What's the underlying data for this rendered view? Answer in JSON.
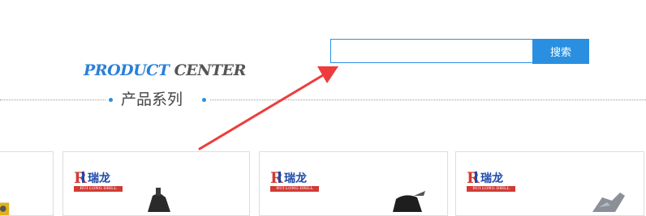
{
  "search": {
    "placeholder": "",
    "value": "",
    "button_label": "搜索"
  },
  "section": {
    "title_accent": "PRODUCT",
    "title_rest": "CENTER",
    "subtitle": "产品系列"
  },
  "colors": {
    "accent": "#2a8fe0",
    "annotation_arrow": "#ee3c3c",
    "logo_red": "#d23b35",
    "logo_blue": "#1f4aa8"
  },
  "products": [
    {
      "logo_mark": "R",
      "logo_name": "瑞龙",
      "logo_text": "RUI LONG DRILL"
    },
    {
      "logo_mark": "R",
      "logo_name": "瑞龙",
      "logo_text": "RUI LONG DRILL"
    },
    {
      "logo_mark": "R",
      "logo_name": "瑞龙",
      "logo_text": "RUI LONG DRILL"
    }
  ]
}
